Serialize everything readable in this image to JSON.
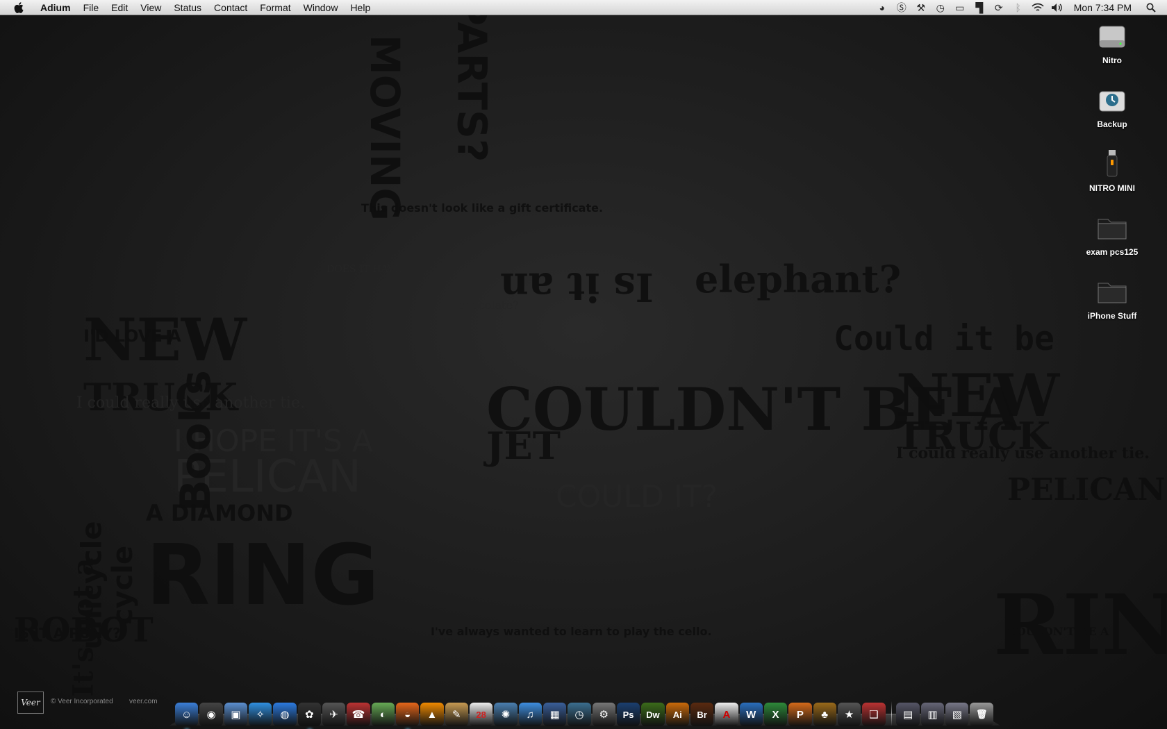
{
  "menubar": {
    "apple_icon": "apple-logo-icon",
    "app_name": "Adium",
    "menus": [
      "File",
      "Edit",
      "View",
      "Status",
      "Contact",
      "Format",
      "Window",
      "Help"
    ],
    "tray_icons": [
      "adium-duck-icon",
      "skype-icon",
      "wrench-icon",
      "time-machine-icon",
      "display-icon",
      "dashboard-icon",
      "sync-icon",
      "bluetooth-icon",
      "wifi-icon",
      "volume-icon"
    ],
    "clock": "Mon 7:34 PM",
    "spotlight_icon": "magnifier-icon"
  },
  "desktop": {
    "icons": [
      {
        "label": "Nitro",
        "icon": "hard-drive-icon"
      },
      {
        "label": "Backup",
        "icon": "time-machine-drive-icon"
      },
      {
        "label": "NITRO MINI",
        "icon": "usb-drive-icon"
      },
      {
        "label": "exam pcs125",
        "icon": "folder-icon"
      },
      {
        "label": "iPhone Stuff",
        "icon": "folder-icon"
      }
    ]
  },
  "wallpaper": {
    "credit": "© Veer Incorporated",
    "url": "veer.com",
    "logo": "Veer",
    "words": [
      "NEW",
      "TRUCK",
      "I'D LOVE A",
      "I could really use another tie.",
      "I HOPE IT'S A",
      "PELICAN",
      "A DIAMOND",
      "RING",
      "MOVING",
      "PARTS?",
      "DOES IT HAVE",
      "Books",
      "cycle",
      "unicycle",
      "It's not a",
      "elephant?",
      "Is it an",
      "chocolate?",
      "Could it be",
      "This doesn't look like a gift certificate.",
      "I've always wanted to learn to play the cello.",
      "ROBOT",
      "IS IT A PONY?",
      "COULDN'T BE A",
      "JET",
      "COULD IT?"
    ]
  },
  "dock": {
    "apps": [
      {
        "name": "finder-icon",
        "color": "#3b7fd8",
        "glyph": "☺",
        "running": true
      },
      {
        "name": "dashboard-icon",
        "color": "#444",
        "glyph": "◉",
        "running": false
      },
      {
        "name": "preview-icon",
        "color": "#5b8fd0",
        "glyph": "▣",
        "running": false
      },
      {
        "name": "safari-icon",
        "color": "#2f8fe0",
        "glyph": "✧",
        "running": false
      },
      {
        "name": "ichat-icon",
        "color": "#2c7be0",
        "glyph": "◍",
        "running": false
      },
      {
        "name": "adium-icon",
        "color": "#333",
        "glyph": "✿",
        "running": true
      },
      {
        "name": "cyberduck-icon",
        "color": "#555",
        "glyph": "✈",
        "running": false
      },
      {
        "name": "address-book-icon",
        "color": "#b33",
        "glyph": "☎",
        "running": false
      },
      {
        "name": "onion-browser-icon",
        "color": "#6a5",
        "glyph": "◐",
        "running": false
      },
      {
        "name": "firefox-icon",
        "color": "#e6661a",
        "glyph": "◒",
        "running": true
      },
      {
        "name": "vlc-icon",
        "color": "#f08a00",
        "glyph": "▲",
        "running": false
      },
      {
        "name": "notes-icon",
        "color": "#c79a52",
        "glyph": "✎",
        "running": false
      },
      {
        "name": "ical-icon",
        "color": "#eee",
        "glyph": "28",
        "running": false
      },
      {
        "name": "iphoto-icon",
        "color": "#4a7fb0",
        "glyph": "✺",
        "running": false
      },
      {
        "name": "itunes-icon",
        "color": "#3e8ee0",
        "glyph": "♫",
        "running": false
      },
      {
        "name": "expose-icon",
        "color": "#3a5f9a",
        "glyph": "▦",
        "running": false
      },
      {
        "name": "time-machine-icon",
        "color": "#3b6e8f",
        "glyph": "◷",
        "running": false
      },
      {
        "name": "system-preferences-icon",
        "color": "#777",
        "glyph": "⚙",
        "running": false
      },
      {
        "name": "photoshop-icon",
        "color": "#1b3f6f",
        "glyph": "Ps",
        "running": false
      },
      {
        "name": "dreamweaver-icon",
        "color": "#3b6b1a",
        "glyph": "Dw",
        "running": false
      },
      {
        "name": "illustrator-icon",
        "color": "#ca6a0a",
        "glyph": "Ai",
        "running": false
      },
      {
        "name": "bridge-icon",
        "color": "#5a2a10",
        "glyph": "Br",
        "running": false
      },
      {
        "name": "acrobat-icon",
        "color": "#eee",
        "glyph": "A",
        "running": false
      },
      {
        "name": "word-icon",
        "color": "#2a6ebd",
        "glyph": "W",
        "running": false
      },
      {
        "name": "excel-icon",
        "color": "#2e8a3a",
        "glyph": "X",
        "running": false
      },
      {
        "name": "powerpoint-icon",
        "color": "#d46a1a",
        "glyph": "P",
        "running": false
      },
      {
        "name": "cocktail-icon",
        "color": "#9a6a1a",
        "glyph": "♣",
        "running": false
      },
      {
        "name": "imovie-icon",
        "color": "#555",
        "glyph": "★",
        "running": false
      },
      {
        "name": "parallels-icon",
        "color": "#b33",
        "glyph": "❑",
        "running": false
      }
    ],
    "stacks": [
      {
        "name": "downloads-stack-icon",
        "color": "#556",
        "glyph": "▤"
      },
      {
        "name": "applications-stack-icon",
        "color": "#667",
        "glyph": "▥"
      },
      {
        "name": "documents-stack-icon",
        "color": "#778",
        "glyph": "▧"
      },
      {
        "name": "trash-icon",
        "color": "#999",
        "glyph": "🗑"
      }
    ]
  }
}
